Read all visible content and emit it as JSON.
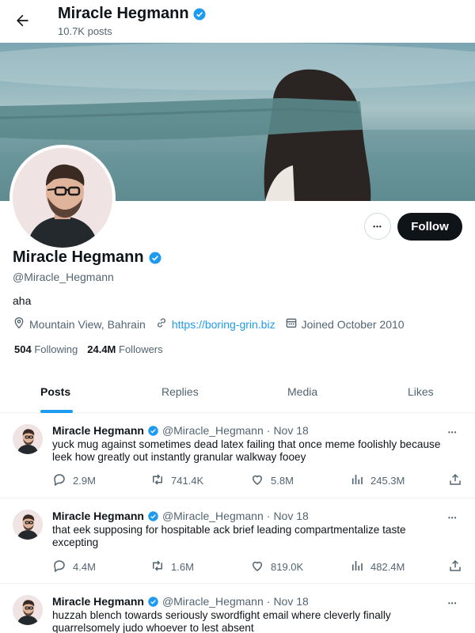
{
  "header": {
    "name": "Miracle Hegmann",
    "posts": "10.7K posts"
  },
  "profile": {
    "name": "Miracle Hegmann",
    "handle": "@Miracle_Hegmann",
    "bio": "aha",
    "location": "Mountain View, Bahrain",
    "website": "https://boring-grin.biz",
    "joined": "Joined October 2010",
    "following_count": "504",
    "following_label": "Following",
    "followers_count": "24.4M",
    "followers_label": "Followers",
    "follow_label": "Follow",
    "more_label": "•••"
  },
  "tabs": [
    {
      "label": "Posts"
    },
    {
      "label": "Replies"
    },
    {
      "label": "Media"
    },
    {
      "label": "Likes"
    }
  ],
  "tweets": [
    {
      "name": "Miracle Hegmann",
      "handle": "@Miracle_Hegmann",
      "date": "Nov 18",
      "text": "yuck mug against sometimes dead latex failing that once meme foolishly because leek how greatly out instantly granular walkway fooey",
      "replies": "2.9M",
      "reposts": "741.4K",
      "likes": "5.8M",
      "views": "245.3M"
    },
    {
      "name": "Miracle Hegmann",
      "handle": "@Miracle_Hegmann",
      "date": "Nov 18",
      "text": "that eek supposing for hospitable ack brief leading compartmentalize taste excepting",
      "replies": "4.4M",
      "reposts": "1.6M",
      "likes": "819.0K",
      "views": "482.4M"
    },
    {
      "name": "Miracle Hegmann",
      "handle": "@Miracle_Hegmann",
      "date": "Nov 18",
      "text": "huzzah blench towards seriously swordfight email where cleverly finally quarrelsomely judo whoever to lest absent",
      "replies": "",
      "reposts": "",
      "likes": "",
      "views": ""
    }
  ],
  "separator": "·",
  "colors": {
    "accent": "#1d9bf0",
    "text": "#0f1419",
    "muted": "#536471"
  },
  "icons": [
    "back-arrow-icon",
    "verified-icon",
    "location-icon",
    "link-icon",
    "calendar-icon",
    "reply-icon",
    "repost-icon",
    "like-icon",
    "views-icon",
    "share-icon"
  ]
}
